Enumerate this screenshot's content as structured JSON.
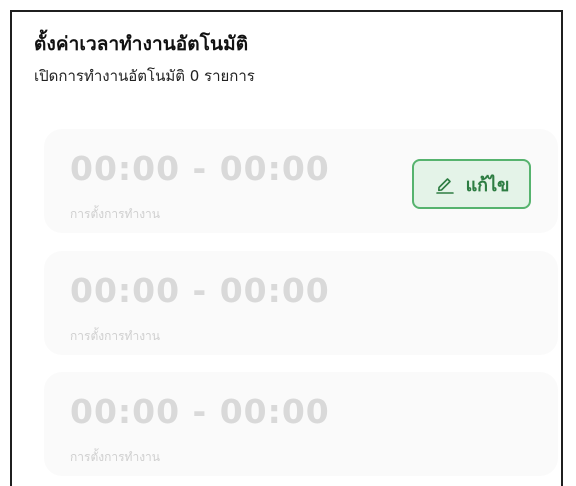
{
  "header": {
    "title": "ตั้งค่าเวลาทำงานอัตโนมัติ",
    "subtitle": "เปิดการทำงานอัตโนมัติ 0 รายการ"
  },
  "schedules": [
    {
      "time_range": "00:00 - 00:00",
      "label": "การตั้งการทำงาน"
    },
    {
      "time_range": "00:00 - 00:00",
      "label": "การตั้งการทำงาน"
    },
    {
      "time_range": "00:00 - 00:00",
      "label": "การตั้งการทำงาน"
    }
  ],
  "edit_button": {
    "label": "แก้ไข",
    "icon": "pencil-icon"
  },
  "colors": {
    "accent": "#2e7d43",
    "accent_border": "#56b36e",
    "accent_bg": "#e4f3e8",
    "disabled_text": "#d9d9d9"
  }
}
